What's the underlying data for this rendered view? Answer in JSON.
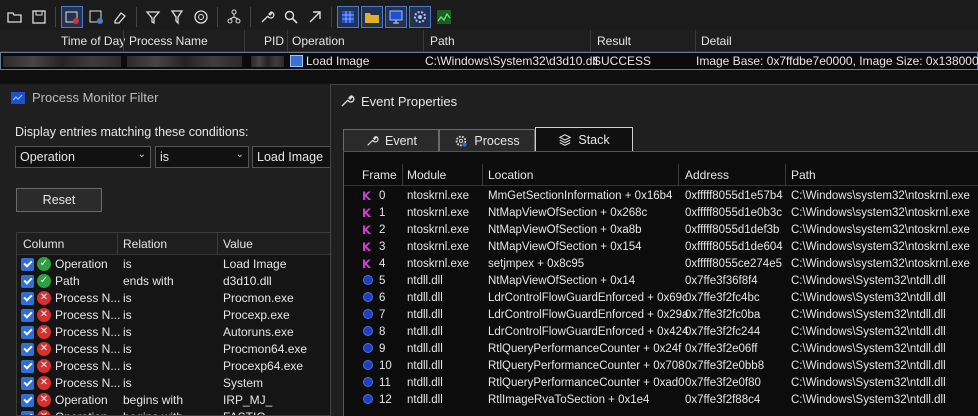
{
  "toolbar": {
    "icons": [
      "open-icon",
      "save-icon",
      "capture-icon",
      "autoscroll-icon",
      "clear-icon",
      "filter-icon",
      "highlight-icon",
      "include-process-icon",
      "process-tree-icon",
      "properties-icon",
      "find-icon",
      "jump-icon",
      "registry-icon",
      "file-system-icon",
      "network-icon",
      "process-thread-icon",
      "profiling-icon"
    ]
  },
  "columns": {
    "time_of_day": "Time of Day",
    "process_name": "Process Name",
    "pid": "PID",
    "operation": "Operation",
    "path": "Path",
    "result": "Result",
    "detail": "Detail"
  },
  "event": {
    "operation": "Load Image",
    "path": "C:\\Windows\\System32\\d3d10.dll",
    "result": "SUCCESS",
    "detail": "Image Base: 0x7ffdbe7e0000, Image Size: 0x138000"
  },
  "filter": {
    "title": "Process Monitor Filter",
    "label": "Display entries matching these conditions:",
    "column_value": "Operation",
    "relation_value": "is",
    "value_value": "Load Image",
    "reset_label": "Reset",
    "headers": {
      "column": "Column",
      "relation": "Relation",
      "value": "Value"
    },
    "rows": [
      {
        "column": "Operation",
        "relation": "is",
        "value": "Load Image",
        "action": "include"
      },
      {
        "column": "Path",
        "relation": "ends with",
        "value": "d3d10.dll",
        "action": "include"
      },
      {
        "column": "Process N...",
        "relation": "is",
        "value": "Procmon.exe",
        "action": "exclude"
      },
      {
        "column": "Process N...",
        "relation": "is",
        "value": "Procexp.exe",
        "action": "exclude"
      },
      {
        "column": "Process N...",
        "relation": "is",
        "value": "Autoruns.exe",
        "action": "exclude"
      },
      {
        "column": "Process N...",
        "relation": "is",
        "value": "Procmon64.exe",
        "action": "exclude"
      },
      {
        "column": "Process N...",
        "relation": "is",
        "value": "Procexp64.exe",
        "action": "exclude"
      },
      {
        "column": "Process N...",
        "relation": "is",
        "value": "System",
        "action": "exclude"
      },
      {
        "column": "Operation",
        "relation": "begins with",
        "value": "IRP_MJ_",
        "action": "exclude"
      },
      {
        "column": "Operation",
        "relation": "begins with",
        "value": "FASTIO_",
        "action": "exclude"
      }
    ]
  },
  "properties": {
    "title": "Event Properties",
    "tabs": [
      {
        "label": "Event",
        "icon": "wrench-icon"
      },
      {
        "label": "Process",
        "icon": "gear-icon"
      },
      {
        "label": "Stack",
        "icon": "stack-icon"
      }
    ],
    "headers": {
      "frame": "Frame",
      "module": "Module",
      "location": "Location",
      "address": "Address",
      "path": "Path"
    },
    "rows": [
      {
        "mode": "K",
        "frame": "0",
        "module": "ntoskrnl.exe",
        "location": "MmGetSectionInformation + 0x16b4",
        "address": "0xfffff8055d1e57b4",
        "path": "C:\\Windows\\system32\\ntoskrnl.exe"
      },
      {
        "mode": "K",
        "frame": "1",
        "module": "ntoskrnl.exe",
        "location": "NtMapViewOfSection + 0x268c",
        "address": "0xfffff8055d1e0b3c",
        "path": "C:\\Windows\\system32\\ntoskrnl.exe"
      },
      {
        "mode": "K",
        "frame": "2",
        "module": "ntoskrnl.exe",
        "location": "NtMapViewOfSection + 0xa8b",
        "address": "0xfffff8055d1def3b",
        "path": "C:\\Windows\\system32\\ntoskrnl.exe"
      },
      {
        "mode": "K",
        "frame": "3",
        "module": "ntoskrnl.exe",
        "location": "NtMapViewOfSection + 0x154",
        "address": "0xfffff8055d1de604",
        "path": "C:\\Windows\\system32\\ntoskrnl.exe"
      },
      {
        "mode": "K",
        "frame": "4",
        "module": "ntoskrnl.exe",
        "location": "setjmpex + 0x8c95",
        "address": "0xfffff8055ce274e5",
        "path": "C:\\Windows\\system32\\ntoskrnl.exe"
      },
      {
        "mode": "U",
        "frame": "5",
        "module": "ntdll.dll",
        "location": "NtMapViewOfSection + 0x14",
        "address": "0x7ffe3f36f8f4",
        "path": "C:\\Windows\\System32\\ntdll.dll"
      },
      {
        "mode": "U",
        "frame": "6",
        "module": "ntdll.dll",
        "location": "LdrControlFlowGuardEnforced + 0x69c",
        "address": "0x7ffe3f2fc4bc",
        "path": "C:\\Windows\\System32\\ntdll.dll"
      },
      {
        "mode": "U",
        "frame": "7",
        "module": "ntdll.dll",
        "location": "LdrControlFlowGuardEnforced + 0x29a",
        "address": "0x7ffe3f2fc0ba",
        "path": "C:\\Windows\\System32\\ntdll.dll"
      },
      {
        "mode": "U",
        "frame": "8",
        "module": "ntdll.dll",
        "location": "LdrControlFlowGuardEnforced + 0x424",
        "address": "0x7ffe3f2fc244",
        "path": "C:\\Windows\\System32\\ntdll.dll"
      },
      {
        "mode": "U",
        "frame": "9",
        "module": "ntdll.dll",
        "location": "RtlQueryPerformanceCounter + 0x24f",
        "address": "0x7ffe3f2e06ff",
        "path": "C:\\Windows\\System32\\ntdll.dll"
      },
      {
        "mode": "U",
        "frame": "10",
        "module": "ntdll.dll",
        "location": "RtlQueryPerformanceCounter + 0x708",
        "address": "0x7ffe3f2e0bb8",
        "path": "C:\\Windows\\System32\\ntdll.dll"
      },
      {
        "mode": "U",
        "frame": "11",
        "module": "ntdll.dll",
        "location": "RtlQueryPerformanceCounter + 0xad0",
        "address": "0x7ffe3f2e0f80",
        "path": "C:\\Windows\\System32\\ntdll.dll"
      },
      {
        "mode": "U",
        "frame": "12",
        "module": "ntdll.dll",
        "location": "RtlImageRvaToSection + 0x1e4",
        "address": "0x7ffe3f2f88c4",
        "path": "C:\\Windows\\System32\\ntdll.dll"
      }
    ]
  },
  "colors": {
    "accent": "#4a7bd1",
    "include": "#2ea043",
    "exclude": "#d6302f",
    "kernel": "#d23fd1",
    "user": "#1e3fbf"
  }
}
